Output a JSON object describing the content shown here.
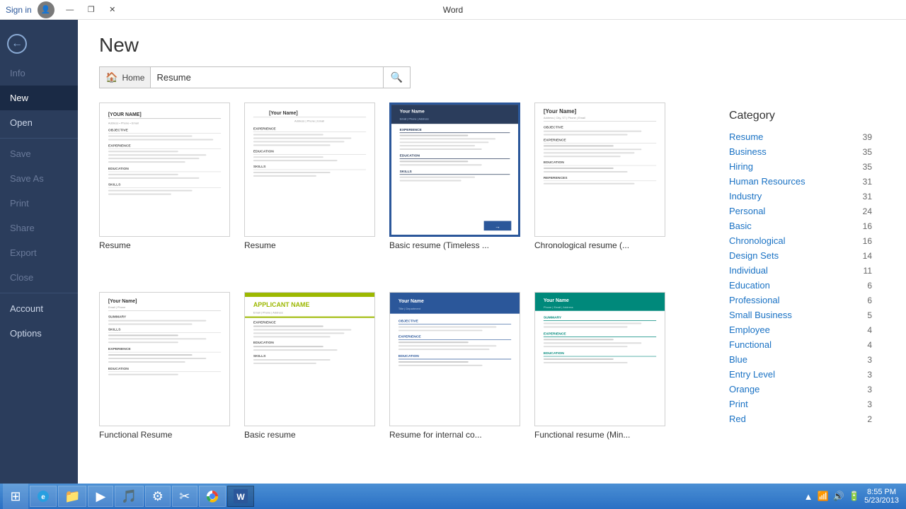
{
  "titlebar": {
    "title": "Word",
    "sign_in": "Sign in",
    "controls": [
      "—",
      "❐",
      "✕"
    ]
  },
  "sidebar": {
    "back_label": "←",
    "items": [
      {
        "id": "info",
        "label": "Info",
        "disabled": true
      },
      {
        "id": "new",
        "label": "New",
        "active": true
      },
      {
        "id": "open",
        "label": "Open",
        "disabled": false
      },
      {
        "id": "save",
        "label": "Save",
        "disabled": true
      },
      {
        "id": "save-as",
        "label": "Save As",
        "disabled": true
      },
      {
        "id": "print",
        "label": "Print",
        "disabled": true
      },
      {
        "id": "share",
        "label": "Share",
        "disabled": true
      },
      {
        "id": "export",
        "label": "Export",
        "disabled": true
      },
      {
        "id": "close",
        "label": "Close",
        "disabled": true
      },
      {
        "id": "account",
        "label": "Account",
        "disabled": false
      },
      {
        "id": "options",
        "label": "Options",
        "disabled": false
      }
    ]
  },
  "content": {
    "page_title": "New",
    "search": {
      "home_label": "Home",
      "placeholder": "Resume",
      "search_icon": "🔍"
    }
  },
  "templates": [
    {
      "id": "t1",
      "label": "Resume",
      "selected": false,
      "style": "plain"
    },
    {
      "id": "t2",
      "label": "Resume",
      "selected": false,
      "style": "plain2"
    },
    {
      "id": "t3",
      "label": "Basic resume (Timeless ...",
      "selected": true,
      "style": "dark-header"
    },
    {
      "id": "t4",
      "label": "Chronological resume (...",
      "selected": false,
      "style": "plain3"
    },
    {
      "id": "t5",
      "label": "Functional Resume",
      "selected": false,
      "style": "plain4"
    },
    {
      "id": "t6",
      "label": "Basic resume",
      "selected": false,
      "style": "yellow-accent"
    },
    {
      "id": "t7",
      "label": "Resume for internal co...",
      "selected": false,
      "style": "blue-banner"
    },
    {
      "id": "t8",
      "label": "Functional resume (Min...",
      "selected": false,
      "style": "teal-banner"
    }
  ],
  "category": {
    "title": "Category",
    "items": [
      {
        "label": "Resume",
        "count": 39
      },
      {
        "label": "Business",
        "count": 35
      },
      {
        "label": "Hiring",
        "count": 35
      },
      {
        "label": "Human Resources",
        "count": 31
      },
      {
        "label": "Industry",
        "count": 31
      },
      {
        "label": "Personal",
        "count": 24
      },
      {
        "label": "Basic",
        "count": 16
      },
      {
        "label": "Chronological",
        "count": 16
      },
      {
        "label": "Design Sets",
        "count": 14
      },
      {
        "label": "Individual",
        "count": 11
      },
      {
        "label": "Education",
        "count": 6
      },
      {
        "label": "Professional",
        "count": 6
      },
      {
        "label": "Small Business",
        "count": 5
      },
      {
        "label": "Employee",
        "count": 4
      },
      {
        "label": "Functional",
        "count": 4
      },
      {
        "label": "Blue",
        "count": 3
      },
      {
        "label": "Entry Level",
        "count": 3
      },
      {
        "label": "Orange",
        "count": 3
      },
      {
        "label": "Print",
        "count": 3
      },
      {
        "label": "Red",
        "count": 2
      }
    ]
  },
  "taskbar": {
    "apps": [
      {
        "id": "start",
        "icon": "⊞"
      },
      {
        "id": "ie",
        "icon": "🌐"
      },
      {
        "id": "folder",
        "icon": "📁"
      },
      {
        "id": "media",
        "icon": "▶"
      },
      {
        "id": "music",
        "icon": "🎵"
      },
      {
        "id": "settings",
        "icon": "⚙"
      },
      {
        "id": "word",
        "icon": "W",
        "active": true
      }
    ],
    "tray": {
      "time": "8:55 PM",
      "date": "5/23/2013"
    }
  }
}
